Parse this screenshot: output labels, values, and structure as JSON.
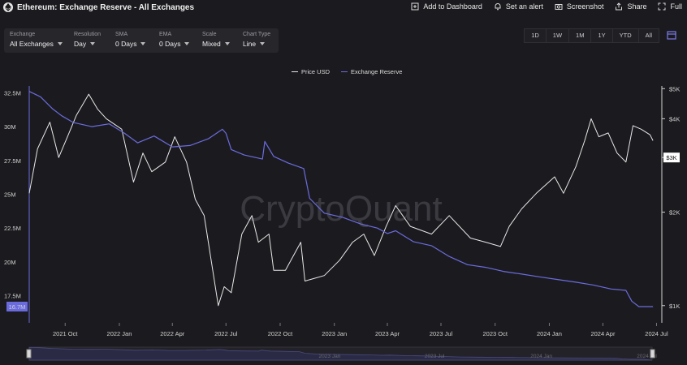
{
  "header": {
    "title": "Ethereum: Exchange Reserve - All Exchanges",
    "actions": [
      "Add to Dashboard",
      "Set an alert",
      "Screenshot",
      "Share",
      "Full"
    ]
  },
  "controls": [
    {
      "label": "Exchange",
      "value": "All Exchanges"
    },
    {
      "label": "Resolution",
      "value": "Day"
    },
    {
      "label": "SMA",
      "value": "0 Days"
    },
    {
      "label": "EMA",
      "value": "0 Days"
    },
    {
      "label": "Scale",
      "value": "Mixed"
    },
    {
      "label": "Chart Type",
      "value": "Line"
    }
  ],
  "ranges": [
    "1D",
    "1W",
    "1M",
    "1Y",
    "YTD",
    "All"
  ],
  "watermark": "CryptoQuant",
  "colors": {
    "price": "#e8e8e8",
    "reserve": "#6b6be0",
    "background": "#1b1b1f"
  },
  "chart_data": {
    "type": "line",
    "legend": [
      "Price USD",
      "Exchange Reserve"
    ],
    "x_ticks": [
      "2021 Oct",
      "2022 Jan",
      "2022 Apr",
      "2022 Jul",
      "2022 Oct",
      "2023 Jan",
      "2023 Apr",
      "2023 Jul",
      "2023 Oct",
      "2024 Jan",
      "2024 Apr",
      "2024 Jul"
    ],
    "y_left_ticks": [
      "32.5M",
      "30M",
      "27.5M",
      "25M",
      "22.5M",
      "20M",
      "17.5M"
    ],
    "y_right_ticks": [
      "$5K",
      "$4K",
      "$3K",
      "$2K",
      "$1K"
    ],
    "y_left_range": [
      15.5,
      33.0
    ],
    "y_right_scale": "log",
    "y_right_range": [
      880,
      5100
    ],
    "current_reserve_label": "16.7M",
    "current_price_label": "$3K",
    "navigator_ticks": [
      "2023 Jan",
      "2023 Jul",
      "2024 Jan",
      "2024 Jul"
    ],
    "series": [
      {
        "name": "Exchange Reserve",
        "unit": "M ETH",
        "points": [
          [
            "2021-08-01",
            32.6
          ],
          [
            "2021-08-20",
            32.2
          ],
          [
            "2021-09-10",
            31.3
          ],
          [
            "2021-09-25",
            30.8
          ],
          [
            "2021-10-15",
            30.3
          ],
          [
            "2021-11-15",
            30.0
          ],
          [
            "2021-12-15",
            30.2
          ],
          [
            "2022-01-10",
            29.5
          ],
          [
            "2022-02-01",
            28.8
          ],
          [
            "2022-03-01",
            29.3
          ],
          [
            "2022-04-01",
            28.5
          ],
          [
            "2022-05-01",
            28.6
          ],
          [
            "2022-06-01",
            29.1
          ],
          [
            "2022-06-25",
            29.8
          ],
          [
            "2022-07-01",
            29.5
          ],
          [
            "2022-07-10",
            28.3
          ],
          [
            "2022-08-01",
            27.9
          ],
          [
            "2022-09-01",
            27.6
          ],
          [
            "2022-09-05",
            28.9
          ],
          [
            "2022-09-20",
            27.8
          ],
          [
            "2022-10-15",
            27.3
          ],
          [
            "2022-11-10",
            26.9
          ],
          [
            "2022-11-20",
            24.7
          ],
          [
            "2022-12-15",
            23.6
          ],
          [
            "2023-01-15",
            23.3
          ],
          [
            "2023-02-15",
            22.8
          ],
          [
            "2023-03-15",
            22.5
          ],
          [
            "2023-04-01",
            22.1
          ],
          [
            "2023-04-15",
            22.3
          ],
          [
            "2023-05-15",
            21.5
          ],
          [
            "2023-06-15",
            21.2
          ],
          [
            "2023-07-15",
            20.4
          ],
          [
            "2023-08-15",
            19.8
          ],
          [
            "2023-09-15",
            19.6
          ],
          [
            "2023-10-15",
            19.3
          ],
          [
            "2023-11-15",
            19.1
          ],
          [
            "2023-12-15",
            18.9
          ],
          [
            "2024-01-15",
            18.7
          ],
          [
            "2024-02-15",
            18.5
          ],
          [
            "2024-03-15",
            18.3
          ],
          [
            "2024-04-15",
            18.0
          ],
          [
            "2024-05-10",
            17.9
          ],
          [
            "2024-05-20",
            17.1
          ],
          [
            "2024-06-01",
            16.7
          ],
          [
            "2024-06-25",
            16.7
          ]
        ]
      },
      {
        "name": "Price USD",
        "unit": "USD",
        "points": [
          [
            "2021-08-01",
            2300
          ],
          [
            "2021-08-15",
            3200
          ],
          [
            "2021-09-05",
            3900
          ],
          [
            "2021-09-20",
            3000
          ],
          [
            "2021-10-05",
            3500
          ],
          [
            "2021-10-20",
            4100
          ],
          [
            "2021-11-10",
            4800
          ],
          [
            "2021-11-25",
            4300
          ],
          [
            "2021-12-10",
            4000
          ],
          [
            "2022-01-05",
            3700
          ],
          [
            "2022-01-25",
            2500
          ],
          [
            "2022-02-10",
            3100
          ],
          [
            "2022-02-25",
            2700
          ],
          [
            "2022-03-20",
            2900
          ],
          [
            "2022-04-05",
            3500
          ],
          [
            "2022-04-25",
            2900
          ],
          [
            "2022-05-10",
            2200
          ],
          [
            "2022-05-25",
            1950
          ],
          [
            "2022-06-18",
            1000
          ],
          [
            "2022-06-28",
            1150
          ],
          [
            "2022-07-10",
            1100
          ],
          [
            "2022-07-28",
            1700
          ],
          [
            "2022-08-14",
            1950
          ],
          [
            "2022-08-25",
            1600
          ],
          [
            "2022-09-12",
            1700
          ],
          [
            "2022-09-20",
            1300
          ],
          [
            "2022-10-10",
            1300
          ],
          [
            "2022-11-05",
            1600
          ],
          [
            "2022-11-12",
            1200
          ],
          [
            "2022-12-15",
            1250
          ],
          [
            "2023-01-10",
            1400
          ],
          [
            "2023-02-01",
            1600
          ],
          [
            "2023-02-20",
            1700
          ],
          [
            "2023-03-10",
            1450
          ],
          [
            "2023-03-30",
            1800
          ],
          [
            "2023-04-15",
            2100
          ],
          [
            "2023-05-10",
            1800
          ],
          [
            "2023-06-15",
            1700
          ],
          [
            "2023-07-15",
            1950
          ],
          [
            "2023-08-20",
            1650
          ],
          [
            "2023-09-15",
            1600
          ],
          [
            "2023-10-10",
            1550
          ],
          [
            "2023-10-25",
            1800
          ],
          [
            "2023-11-15",
            2050
          ],
          [
            "2023-12-10",
            2300
          ],
          [
            "2024-01-10",
            2600
          ],
          [
            "2024-01-25",
            2300
          ],
          [
            "2024-02-15",
            2800
          ],
          [
            "2024-03-01",
            3400
          ],
          [
            "2024-03-12",
            4000
          ],
          [
            "2024-03-25",
            3500
          ],
          [
            "2024-04-10",
            3600
          ],
          [
            "2024-04-25",
            3100
          ],
          [
            "2024-05-10",
            2900
          ],
          [
            "2024-05-22",
            3800
          ],
          [
            "2024-06-05",
            3700
          ],
          [
            "2024-06-20",
            3550
          ],
          [
            "2024-06-25",
            3400
          ]
        ]
      }
    ]
  }
}
